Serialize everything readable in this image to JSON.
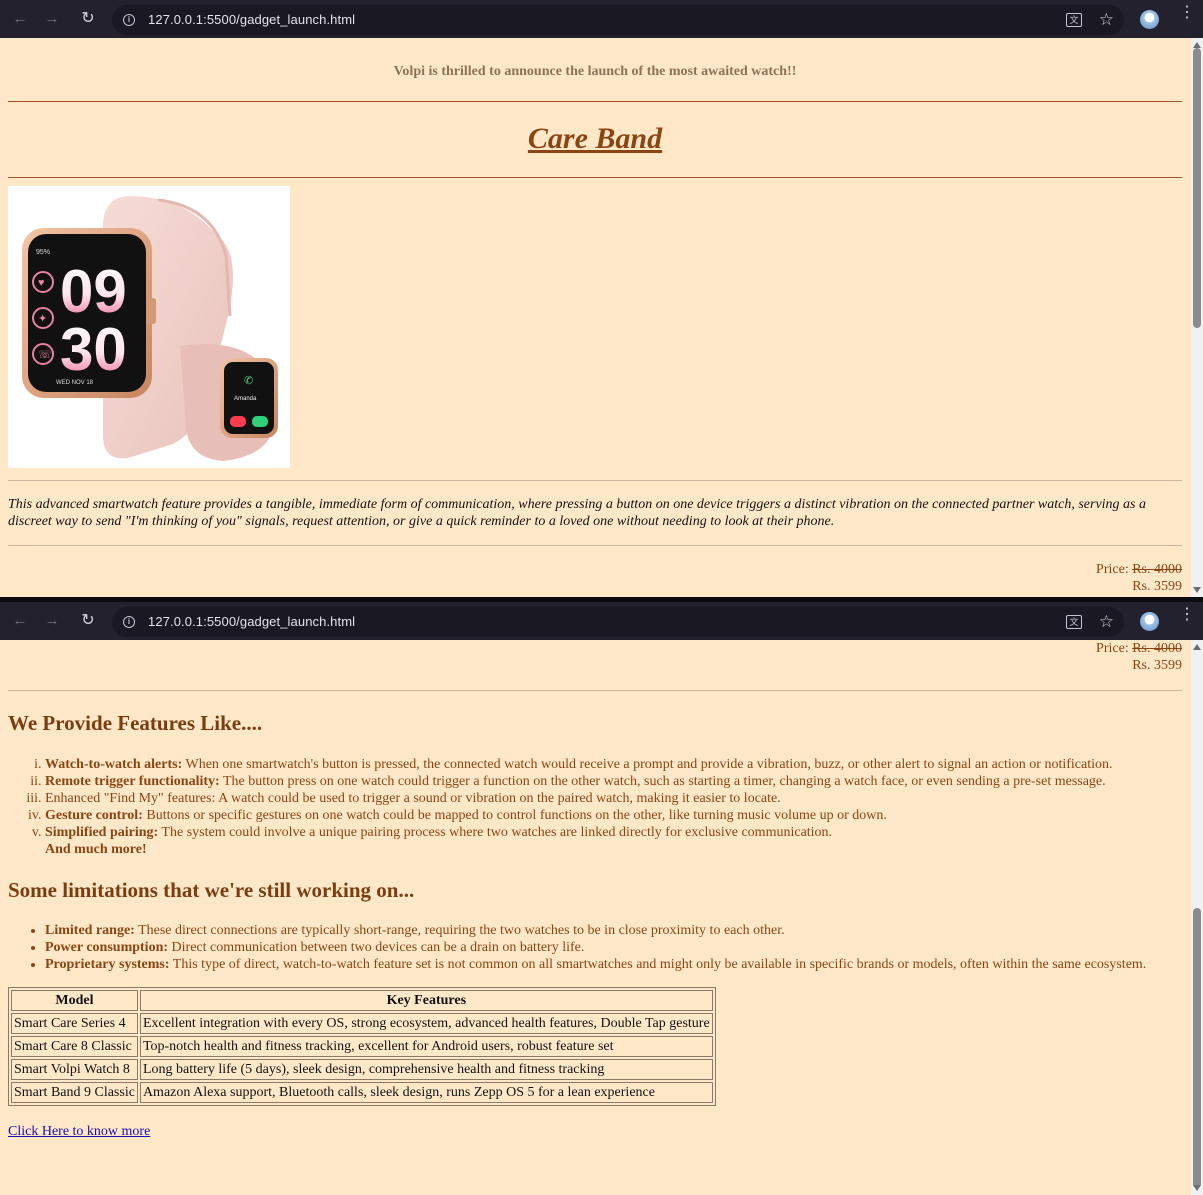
{
  "browser": {
    "url": "127.0.0.1:5500/gadget_launch.html",
    "icons": [
      "back-arrow-icon",
      "forward-arrow-icon",
      "reload-icon",
      "site-info-icon",
      "translate-icon",
      "bookmark-star-icon",
      "profile-avatar",
      "menu-kebab-icon"
    ]
  },
  "page": {
    "announcement": "Volpi is thrilled to announce the launch of the most awaited watch!!",
    "title": "Care Band",
    "description": "This advanced smartwatch feature provides a tangible, immediate form of communication, where pressing a button on one device triggers a distinct vibration on the connected partner watch, serving as a discreet way to send \"I'm thinking of you\" signals, request attention, or give a quick reminder to a loved one without needing to look at their phone.",
    "price_label": "Price:",
    "old_price": "Rs. 4000",
    "new_price": "Rs. 3599",
    "watch_image": {
      "large_battery": "95%",
      "large_hour": "09",
      "large_minute": "30",
      "large_date": "WED NOV 18",
      "small_caller": "Amanda"
    },
    "features_heading": "We Provide Features Like....",
    "features": [
      {
        "bold": "Watch-to-watch alerts:",
        "text": " When one smartwatch's button is pressed, the connected watch would receive a prompt and provide a vibration, buzz, or other alert to signal an action or notification."
      },
      {
        "bold": "Remote trigger functionality:",
        "text": " The button press on one watch could trigger a function on the other watch, such as starting a timer, changing a watch face, or even sending a pre-set message."
      },
      {
        "bold": "",
        "text": "Enhanced \"Find My\" features: A watch could be used to trigger a sound or vibration on the paired watch, making it easier to locate."
      },
      {
        "bold": "Gesture control:",
        "text": " Buttons or specific gestures on one watch could be mapped to control functions on the other, like turning music volume up or down."
      },
      {
        "bold": "Simplified pairing:",
        "text": " The system could involve a unique pairing process where two watches are linked directly for exclusive communication."
      }
    ],
    "and_more": "And much more!",
    "limits_heading": "Some limitations that we're still working on...",
    "limits": [
      {
        "bold": "Limited range:",
        "text": " These direct connections are typically short-range, requiring the two watches to be in close proximity to each other."
      },
      {
        "bold": "Power consumption:",
        "text": " Direct communication between two devices can be a drain on battery life."
      },
      {
        "bold": "Proprietary systems:",
        "text": " This type of direct, watch-to-watch feature set is not common on all smartwatches and might only be available in specific brands or models, often within the same ecosystem."
      }
    ],
    "table": {
      "headers": [
        "Model",
        "Key Features"
      ],
      "rows": [
        [
          "Smart Care Series 4",
          "Excellent integration with every OS, strong ecosystem, advanced health features, Double Tap gesture"
        ],
        [
          "Smart Care 8 Classic",
          "Top-notch health and fitness tracking, excellent for Android users, robust feature set"
        ],
        [
          "Smart Volpi Watch 8",
          "Long battery life (5 days), sleek design, comprehensive health and fitness tracking"
        ],
        [
          "Smart Band 9 Classic",
          "Amazon Alexa support, Bluetooth calls, sleek design, runs Zepp OS 5 for a lean experience"
        ]
      ]
    },
    "link_text": "Click Here to know more"
  },
  "colors": {
    "page_bg": "#ffe8c8",
    "text_brown": "#8b4513",
    "link_blue": "#1a0dab",
    "chrome_bg": "#24212e"
  }
}
